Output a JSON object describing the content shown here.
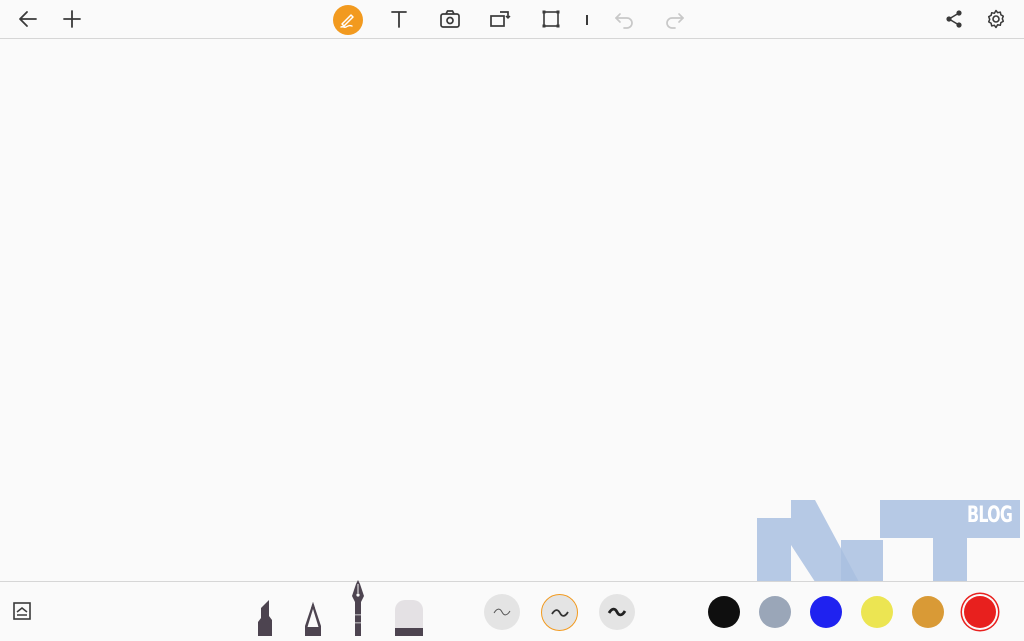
{
  "toolbar": {
    "left": [
      {
        "icon": "back-arrow-icon"
      },
      {
        "icon": "plus-icon"
      }
    ],
    "center": [
      {
        "icon": "pen-draw-icon",
        "active": true,
        "active_color": "#f29a1f"
      },
      {
        "icon": "text-icon"
      },
      {
        "icon": "camera-icon"
      },
      {
        "icon": "rotate-icon"
      },
      {
        "icon": "crop-icon"
      },
      {
        "icon": "undo-icon",
        "enabled": false
      },
      {
        "icon": "redo-icon",
        "enabled": false
      }
    ],
    "right": [
      {
        "icon": "share-icon"
      },
      {
        "icon": "settings-gear-icon"
      }
    ]
  },
  "bottom": {
    "layer_button": {
      "icon": "layers-icon"
    },
    "tools": [
      {
        "name": "marker",
        "icon": "marker-icon"
      },
      {
        "name": "pencil",
        "icon": "pencil-icon"
      },
      {
        "name": "fountain-pen",
        "icon": "fountain-pen-icon",
        "selected": true
      },
      {
        "name": "eraser",
        "icon": "eraser-icon"
      }
    ],
    "stroke_widths": [
      {
        "name": "thin",
        "selected": false
      },
      {
        "name": "medium",
        "selected": true
      },
      {
        "name": "thick",
        "selected": false
      }
    ],
    "colors": [
      {
        "name": "black",
        "hex": "#0f0f0f"
      },
      {
        "name": "gray",
        "hex": "#9aa6b8"
      },
      {
        "name": "blue",
        "hex": "#1f22f0"
      },
      {
        "name": "yellow",
        "hex": "#ece552"
      },
      {
        "name": "orange",
        "hex": "#d99a36"
      },
      {
        "name": "red",
        "hex": "#e8201e",
        "selected": true
      }
    ]
  },
  "watermark": {
    "text": "BLOG",
    "color": "#a9bfe0"
  }
}
